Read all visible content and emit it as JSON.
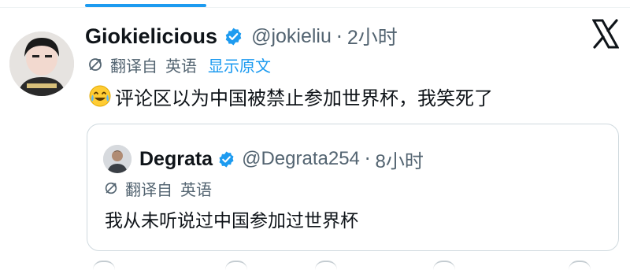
{
  "tweet": {
    "display_name": "Giokielicious",
    "handle": "@jokieliu",
    "separator": "·",
    "time": "2小时",
    "translate_label": "翻译自",
    "language": "英语",
    "show_original": "显示原文",
    "text": "评论区以为中国被禁止参加世界杯，我笑死了",
    "emoji": "crying-laughing-emoji"
  },
  "quoted": {
    "display_name": "Degrata",
    "handle": "@Degrata254",
    "separator": "·",
    "time": "8小时",
    "translate_label": "翻译自",
    "language": "英语",
    "text": "我从未听说过中国参加过世界杯"
  },
  "colors": {
    "accent": "#1d9bf0",
    "text": "#0f1419",
    "muted": "#536471",
    "border": "#cfd9de"
  },
  "icons": {
    "verified": "verified-badge-icon",
    "close": "x-logo-icon",
    "translate": "translate-icon"
  }
}
